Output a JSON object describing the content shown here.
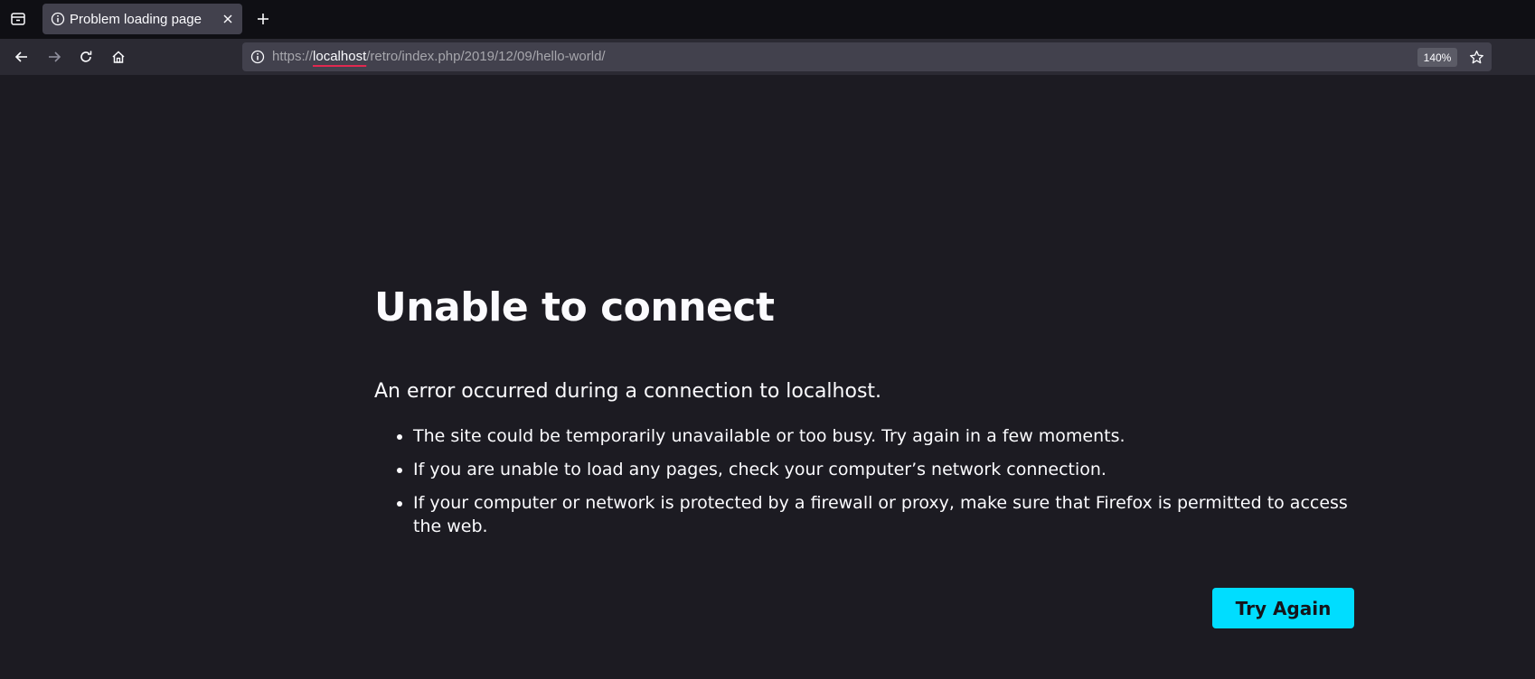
{
  "tab": {
    "title": "Problem loading page",
    "icon": "info-icon"
  },
  "toolbar": {
    "list_tabs_icon": "list-all-tabs-icon",
    "new_tab_icon": "plus-icon",
    "close_tab_icon": "close-icon",
    "back_icon": "arrow-left-icon",
    "forward_icon": "arrow-right-icon",
    "reload_icon": "reload-icon",
    "home_icon": "home-icon",
    "bookmark_icon": "star-icon"
  },
  "urlbar": {
    "scheme": "https://",
    "host": "localhost",
    "path": "/retro/index.php/2019/12/09/hello-world/",
    "zoom": "140%"
  },
  "error": {
    "title": "Unable to connect",
    "description": "An error occurred during a connection to localhost.",
    "items": [
      "The site could be temporarily unavailable or too busy. Try again in a few moments.",
      "If you are unable to load any pages, check your computer’s network connection.",
      "If your computer or network is protected by a firewall or proxy, make sure that Firefox is permitted to access the web."
    ],
    "button_label": "Try Again"
  },
  "colors": {
    "page_background": "#1c1b22",
    "tabstrip_background": "#0f0f14",
    "toolbar_background": "#2b2a33",
    "urlbar_background": "#42414d",
    "accent_button": "#00ddff",
    "host_underline": "#e22850"
  }
}
